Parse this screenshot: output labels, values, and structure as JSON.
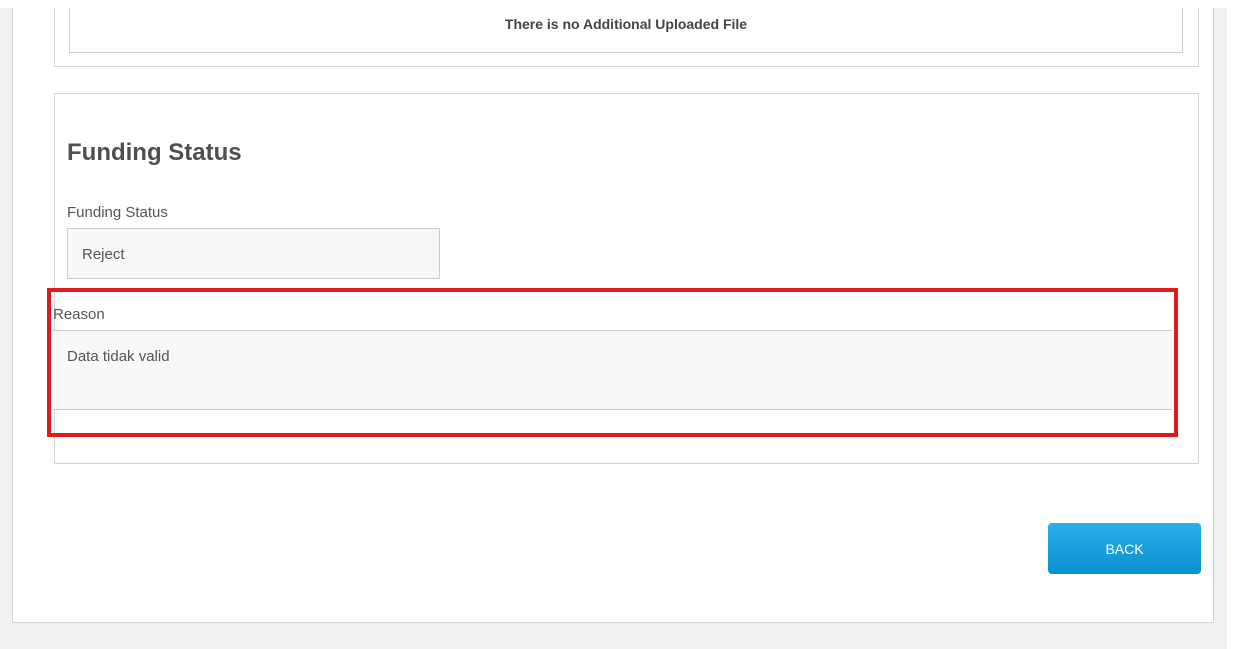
{
  "files": {
    "message": "There is no Additional Uploaded File"
  },
  "funding": {
    "section_title": "Funding Status",
    "status_label": "Funding Status",
    "status_value": "Reject",
    "reason_label": "Reason",
    "reason_value": "Data tidak valid"
  },
  "actions": {
    "back_label": "BACK"
  },
  "colors": {
    "highlight": "#e0191f",
    "button": "#1a9fdc"
  }
}
